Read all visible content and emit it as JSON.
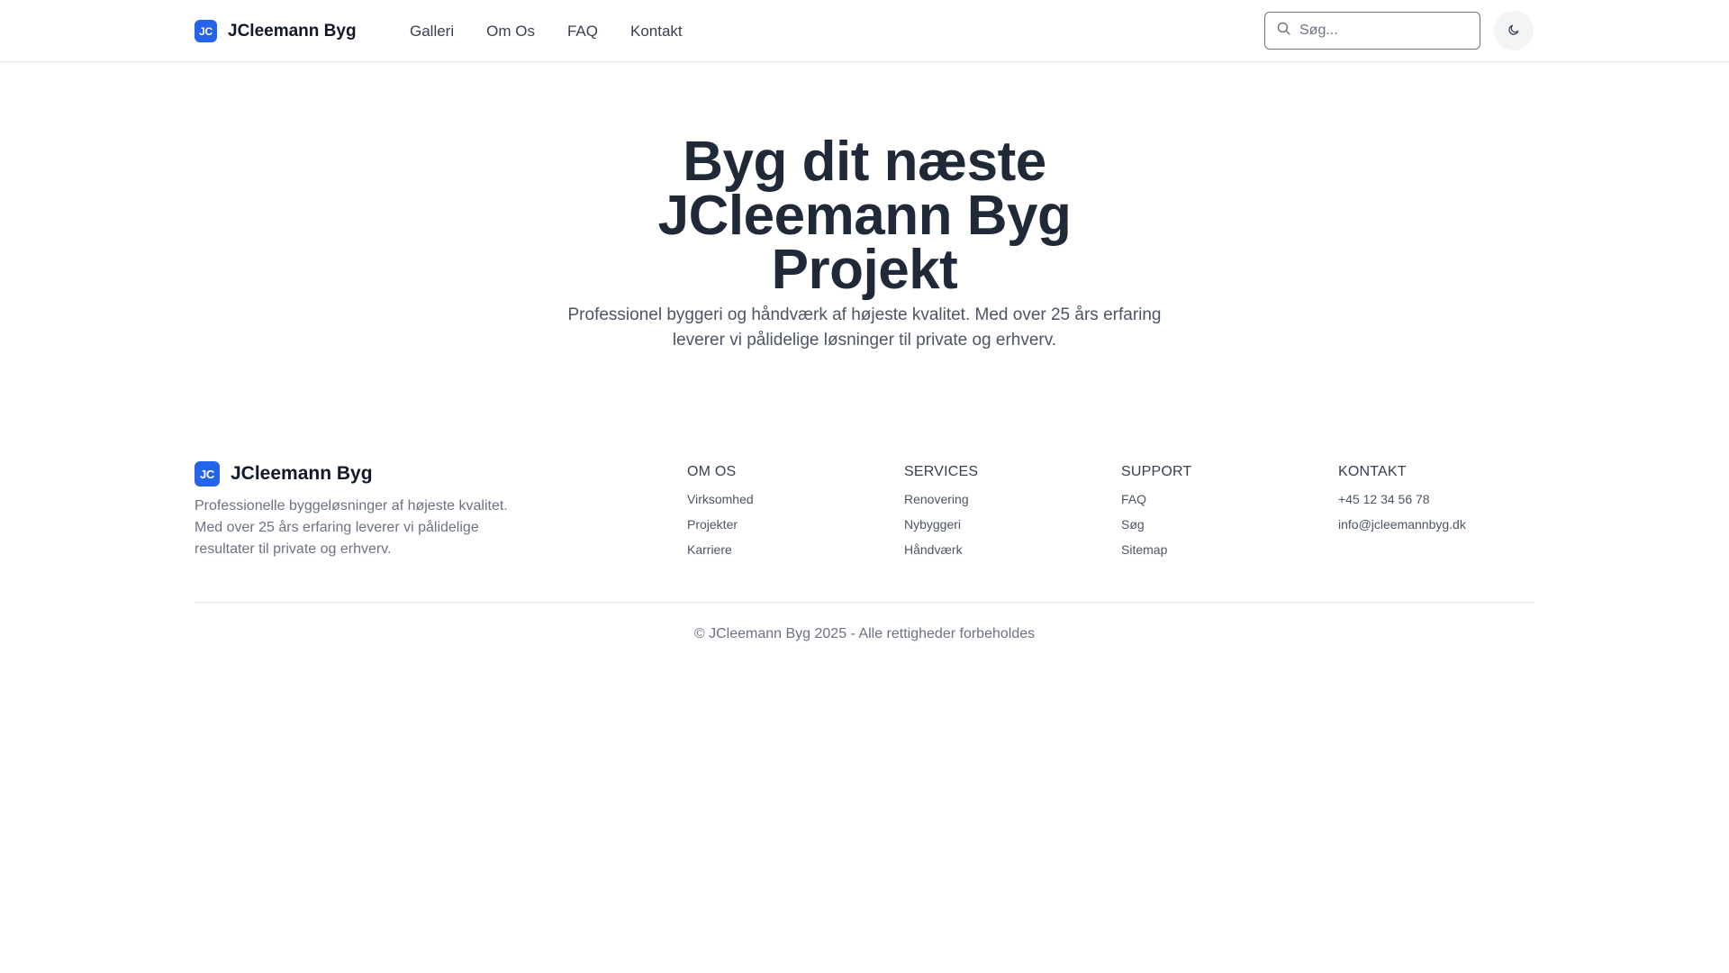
{
  "colors": {
    "accent": "#2563eb",
    "text": "#1f2937",
    "muted": "#6b7280",
    "border": "#e5e7eb"
  },
  "header": {
    "logo_initials": "JC",
    "brand": "JCleemann Byg",
    "nav": [
      {
        "label": "Galleri"
      },
      {
        "label": "Om Os"
      },
      {
        "label": "FAQ"
      },
      {
        "label": "Kontakt"
      }
    ],
    "search": {
      "placeholder": "Søg...",
      "value": "",
      "icon": "search-icon"
    },
    "theme_toggle_icon": "moon-icon"
  },
  "hero": {
    "title_lines": [
      "Byg dit næste",
      "JCleemann Byg",
      "Projekt"
    ],
    "subtitle_lines": [
      "Professionel byggeri og håndværk af højeste kvalitet. Med over 25 års erfaring",
      "leverer vi pålidelige løsninger til private og erhverv."
    ]
  },
  "footer": {
    "logo_initials": "JC",
    "brand": "JCleemann Byg",
    "description_lines": [
      "Professionelle byggeløsninger af højeste kvalitet.",
      "Med over 25 års erfaring leverer vi pålidelige",
      "resultater til private og erhverv."
    ],
    "columns": [
      {
        "title": "OM OS",
        "links": [
          "Virksomhed",
          "Projekter",
          "Karriere"
        ]
      },
      {
        "title": "SERVICES",
        "links": [
          "Renovering",
          "Nybyggeri",
          "Håndværk"
        ]
      },
      {
        "title": "SUPPORT",
        "links": [
          "FAQ",
          "Søg",
          "Sitemap"
        ]
      },
      {
        "title": "KONTAKT",
        "links": [
          "+45 12 34 56 78",
          "info@jcleemannbyg.dk"
        ]
      }
    ],
    "copyright": "© JCleemann Byg 2025 - Alle rettigheder forbeholdes"
  }
}
